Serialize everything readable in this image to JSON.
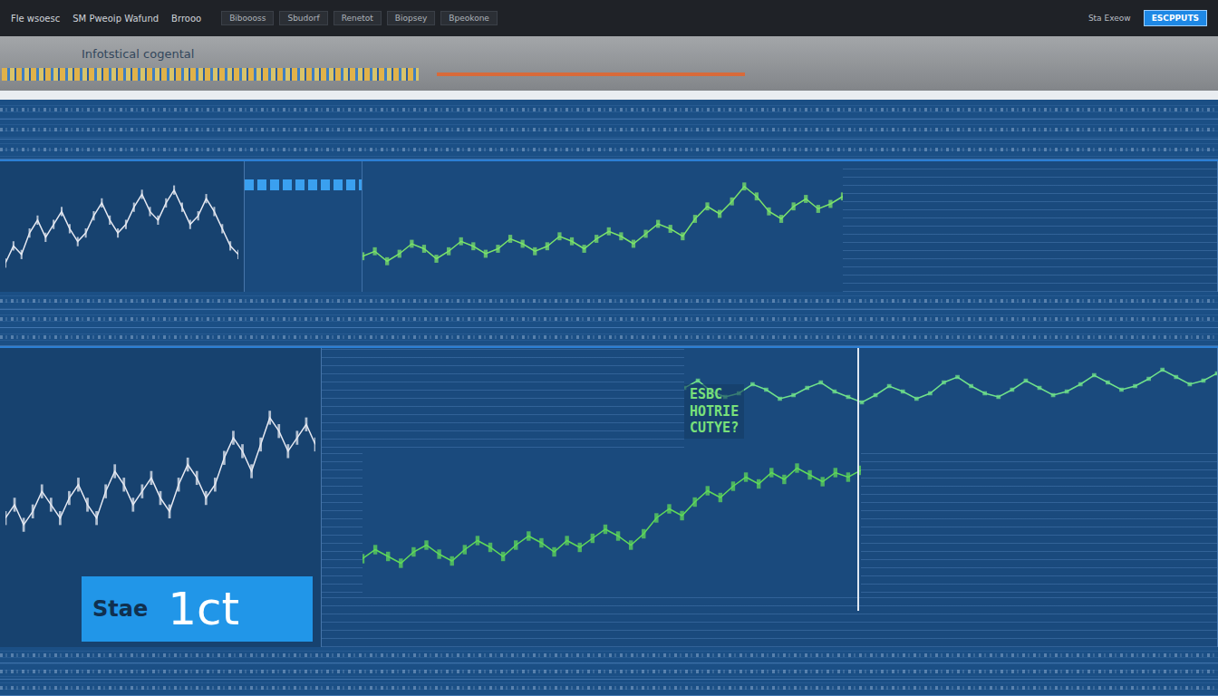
{
  "window": {
    "title": "Infotstical cogental"
  },
  "menu": [
    {
      "label": "Fle wsoesc"
    },
    {
      "label": "SM Pweoip Wafund"
    },
    {
      "label": "Brrooo"
    }
  ],
  "tabs": [
    {
      "label": "Biboooss",
      "selected": false
    },
    {
      "label": "Sbudorf",
      "selected": false
    },
    {
      "label": "Renetot",
      "selected": false
    },
    {
      "label": "Biopsey",
      "selected": false
    },
    {
      "label": "Bpeokone",
      "selected": false
    }
  ],
  "account": "Sta Exeow",
  "action_button": {
    "label": "ESCPPUTS",
    "selected": true
  },
  "charts": {
    "upper_left": {
      "series": [
        {
          "name": "price",
          "color": "#e6e9f2",
          "values": [
            48,
            52,
            50,
            55,
            58,
            54,
            57,
            60,
            56,
            53,
            55,
            59,
            62,
            58,
            55,
            57,
            61,
            64,
            60,
            58,
            62,
            65,
            61,
            57,
            59,
            63,
            60,
            56,
            52,
            50
          ]
        }
      ]
    },
    "upper_main": {
      "series": [
        {
          "name": "price",
          "color": "#7be36a",
          "values": [
            40,
            42,
            38,
            41,
            45,
            43,
            39,
            42,
            46,
            44,
            41,
            43,
            47,
            45,
            42,
            44,
            48,
            46,
            43,
            47,
            50,
            48,
            45,
            49,
            53,
            51,
            48,
            55,
            60,
            57,
            62,
            68,
            64,
            58,
            55,
            60,
            63,
            59,
            61,
            64
          ]
        }
      ]
    },
    "lower_left": {
      "series": [
        {
          "name": "price",
          "color": "#e6e9f2",
          "values": [
            50,
            52,
            49,
            51,
            54,
            52,
            50,
            53,
            55,
            52,
            50,
            54,
            57,
            55,
            52,
            54,
            56,
            53,
            51,
            55,
            58,
            56,
            53,
            55,
            59,
            62,
            60,
            57,
            61,
            65,
            63,
            60,
            62,
            64,
            61
          ]
        }
      ]
    },
    "lower_upper": {
      "series": [
        {
          "name": "price",
          "color": "#6fe08a",
          "values": [
            60,
            64,
            58,
            55,
            57,
            62,
            59,
            54,
            56,
            60,
            63,
            58,
            55,
            52,
            56,
            61,
            58,
            54,
            57,
            63,
            66,
            61,
            57,
            55,
            59,
            64,
            60,
            56,
            58,
            62,
            67,
            63,
            59,
            61,
            65,
            70,
            66,
            62,
            64,
            68
          ]
        }
      ]
    },
    "lower_main": {
      "series": [
        {
          "name": "price",
          "color": "#5fd85a",
          "values": [
            30,
            34,
            31,
            28,
            33,
            36,
            32,
            29,
            34,
            38,
            35,
            31,
            36,
            40,
            37,
            33,
            38,
            35,
            39,
            43,
            40,
            36,
            41,
            48,
            52,
            49,
            55,
            60,
            57,
            62,
            66,
            63,
            68,
            65,
            70,
            67,
            64,
            68,
            66,
            69
          ]
        }
      ]
    }
  },
  "annotation": [
    "ESBC",
    "HOTRIE",
    "CUTYE?"
  ],
  "badge": {
    "label": "Stae",
    "value": "1ct"
  }
}
